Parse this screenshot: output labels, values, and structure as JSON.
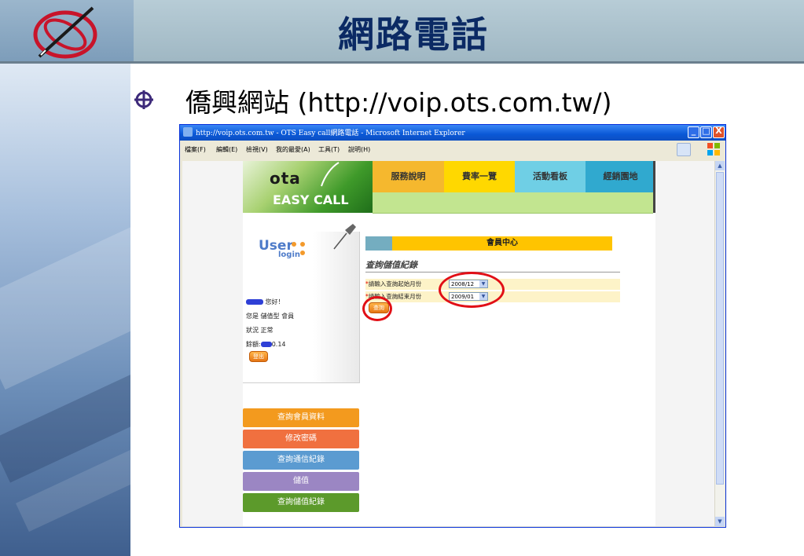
{
  "slide": {
    "title": "網路電話",
    "bullet": "僑興網站 (http://voip.ots.com.tw/)"
  },
  "window": {
    "title": "http://voip.ots.com.tw - OTS Easy call網路電話 - Microsoft Internet Explorer",
    "controls": {
      "minimize": "_",
      "maximize": "□",
      "close": "X"
    },
    "menu": [
      "檔案(F)",
      "編輯(E)",
      "檢視(V)",
      "我的最愛(A)",
      "工具(T)",
      "說明(H)"
    ]
  },
  "site": {
    "logo": "ota",
    "tagline": "EASY CALL",
    "nav": [
      {
        "label": "服務說明",
        "color": "#f5b82e"
      },
      {
        "label": "費率一覽",
        "color": "#ffd800"
      },
      {
        "label": "活動看板",
        "color": "#6fcfe5"
      },
      {
        "label": "經銷園地",
        "color": "#30a9cf"
      }
    ],
    "user_panel": {
      "logo_main": "User",
      "logo_sub": "login",
      "greeting": "您好！",
      "member_type": "您是 儲值型 會員",
      "status": "狀況 正常",
      "balance_label": "餘額:",
      "balance_value": "0.14",
      "logout": "登出"
    },
    "side_menu": [
      {
        "label": "查詢會員資料",
        "color": "#f39a1e"
      },
      {
        "label": "修改密碼",
        "color": "#f0703f"
      },
      {
        "label": "查詢通信紀錄",
        "color": "#5b9bd1"
      },
      {
        "label": "儲值",
        "color": "#9b86c3"
      },
      {
        "label": "查詢儲值紀錄",
        "color": "#5c9a2b"
      }
    ],
    "member_center": {
      "header": "會員中心",
      "section_title": "查詢儲值紀錄",
      "start_label": "請輸入查詢起始月份",
      "start_value": "2008/12",
      "end_label": "請輸入查詢結束月份",
      "end_value": "2009/01",
      "query_button": "查詢"
    }
  }
}
